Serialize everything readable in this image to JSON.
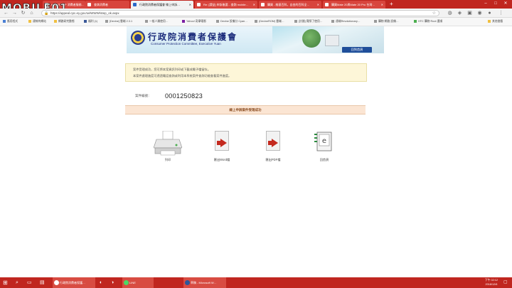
{
  "browser": {
    "tabs": [
      {
        "label": "ePLUS APP 消費者服務…",
        "active": false
      },
      {
        "label": "查詢消費者",
        "active": false
      },
      {
        "label": "行政院消費者保護會 線上申訴…",
        "active": true
      },
      {
        "label": "Re: [請益] 申訴後要…查詢 mobile…",
        "active": false
      },
      {
        "label": "購買 - 維基百科，自由的百科全…",
        "active": false
      },
      {
        "label": "購買Mate 20與Mate 20 Pro 台灣…",
        "active": false
      }
    ],
    "new_tab": "+",
    "url": "https://appeal.cpc.ey.gov.tw/WWW/step_ok.aspx",
    "bookmarks": [
      "應用程式",
      "連線的網站",
      "網路研究動態",
      "福利 (1)",
      "[Devine] 雲端 2.3.1",
      "一般人類使用…",
      "Yahoo! 奇摩電影",
      "Devine 設備分 Cyan…",
      "(DevineROM) 雲端…",
      "[討論] 實際了使用…",
      "遠端Revolutionary…",
      "購物 網路 設備…",
      "HTC 購物 Root 選項",
      "其他書籤"
    ]
  },
  "page": {
    "logo_cn": "行政院消費者保護會",
    "logo_en": "Consumer Protection Committee, Executive Yuan",
    "home_button": "回到首頁",
    "notice_lines": [
      "案件受理成功，您可將本案資訊列印或下載成電子檔留存。",
      "本案件處理進度可透過電話查詢或利用本系統案件查詢功能查看案件進度。"
    ],
    "case_label": "案件編號：",
    "case_number": "0001250823",
    "result_text": "線上申訴案件受理成功",
    "actions": [
      {
        "label": "列印",
        "icon": "printer-icon"
      },
      {
        "label": "匯出Word檔",
        "icon": "word-export-icon"
      },
      {
        "label": "匯出PDF檔",
        "icon": "pdf-export-icon"
      },
      {
        "label": "回首頁",
        "icon": "home-page-icon"
      }
    ]
  },
  "taskbar": {
    "apps": [
      "行政院消費者保護…",
      "LINE",
      "草稿 - Microsoft W…"
    ],
    "clock_time": "下午 02:12",
    "clock_date": "2018/12/6"
  },
  "colors": {
    "brand": "#c0261f",
    "home_button": "#1f4e9a",
    "notice_bg": "#fdf6d8",
    "result_bg": "#fbe5d3"
  }
}
